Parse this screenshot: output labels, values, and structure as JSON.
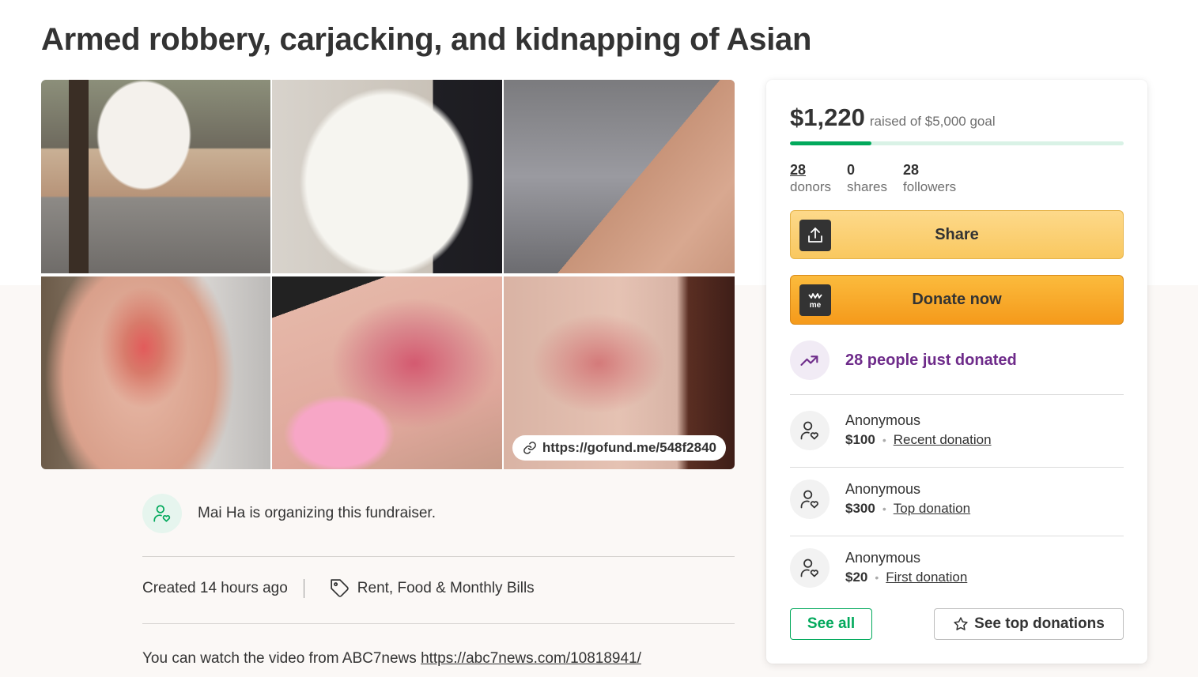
{
  "title": "Armed robbery, carjacking, and kidnapping of Asian",
  "gallery": {
    "link_text": "https://gofund.me/548f2840",
    "link_icon": "link-icon"
  },
  "organizer": {
    "text": "Mai Ha is organizing this fundraiser.",
    "icon": "organizer-heart-icon"
  },
  "meta": {
    "created": "Created 14 hours ago",
    "category": "Rent, Food & Monthly Bills",
    "category_icon": "tag-icon"
  },
  "story": {
    "text": "You can watch the video from ABC7news ",
    "link": "https://abc7news.com/10818941/"
  },
  "donation": {
    "raised": "$1,220",
    "goal_text": "raised of $5,000 goal",
    "progress_percent": 24.4,
    "stats": [
      {
        "value": "28",
        "label": "donors"
      },
      {
        "value": "0",
        "label": "shares"
      },
      {
        "value": "28",
        "label": "followers"
      }
    ],
    "share_label": "Share",
    "donate_label": "Donate now",
    "recent_text": "28 people just donated",
    "donors": [
      {
        "name": "Anonymous",
        "amount": "$100",
        "type": "Recent donation"
      },
      {
        "name": "Anonymous",
        "amount": "$300",
        "type": "Top donation"
      },
      {
        "name": "Anonymous",
        "amount": "$20",
        "type": "First donation"
      }
    ],
    "see_all_label": "See all",
    "see_top_label": "See top donations"
  },
  "colors": {
    "brand_green": "#02a95c",
    "donate_orange": "#f59a1b",
    "share_yellow": "#fbcf6d",
    "trend_purple": "#6e2b8a"
  }
}
